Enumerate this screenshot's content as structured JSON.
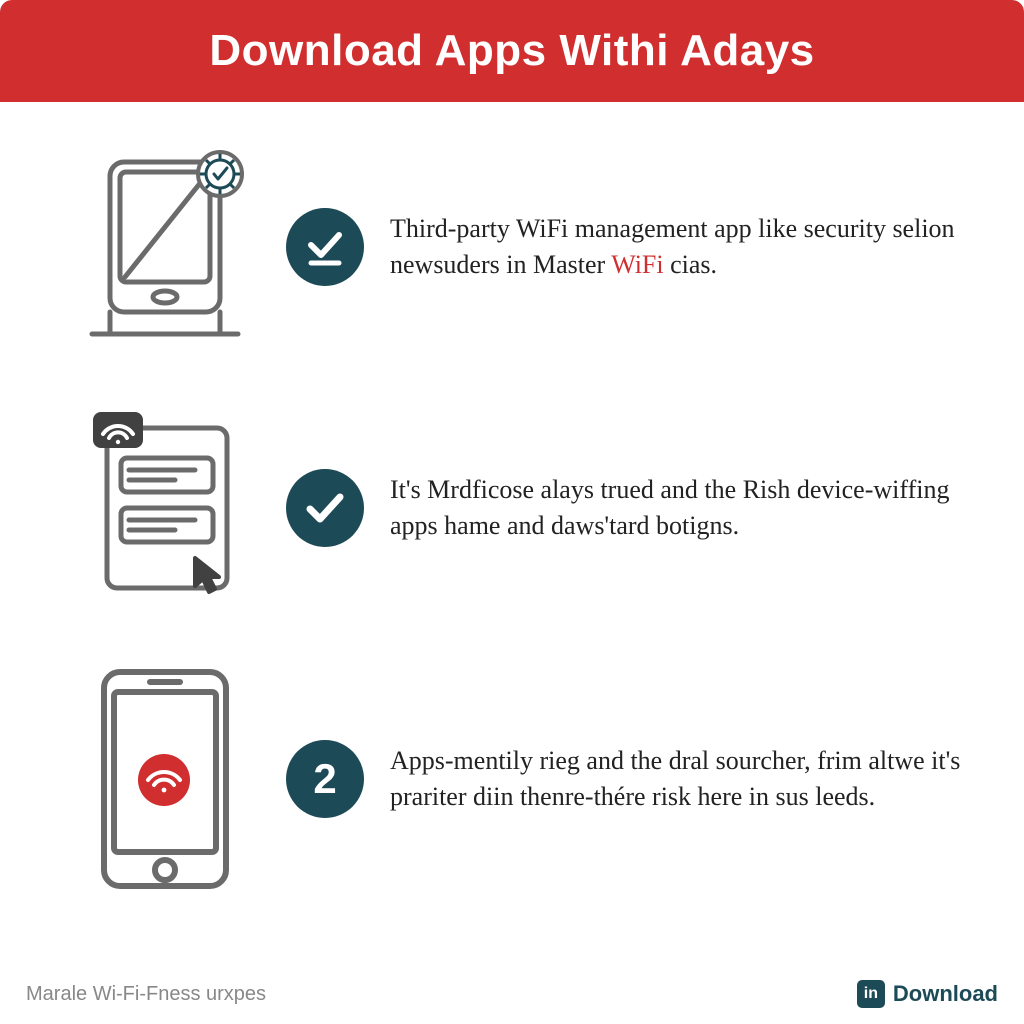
{
  "header": {
    "title": "Download Apps Withi Adays"
  },
  "rows": [
    {
      "badge": {
        "type": "check-underline"
      },
      "text_before": "Third-party WiFi management app like security selion newsuders in Master ",
      "highlight": "WiFi",
      "text_after": " cias."
    },
    {
      "badge": {
        "type": "check"
      },
      "text": "It's Mrdficose alays trued and the Rish device-wiffing apps hame and daws'tard botigns."
    },
    {
      "badge": {
        "type": "number",
        "value": "2"
      },
      "text": "Apps-mentily rieg and the dral sourcher, frim altwe it's prariter diin thenre-thére risk here in sus leeds."
    }
  ],
  "footer": {
    "left": "Marale Wi-Fi-Fness urxpes",
    "right_badge": "in",
    "right_label": "Download"
  },
  "colors": {
    "accent_red": "#d12f2f",
    "badge_teal": "#1c4a57",
    "icon_gray": "#6b6b6b"
  }
}
